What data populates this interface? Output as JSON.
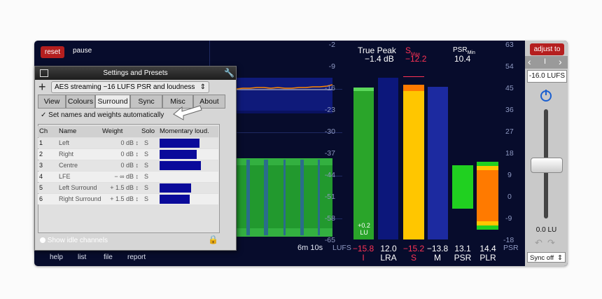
{
  "topbar": {
    "reset_label": "reset",
    "pause_label": "pause"
  },
  "bottombar": {
    "help": "help",
    "list": "list",
    "file": "file",
    "report": "report"
  },
  "graph": {
    "elapsed": "6m 10s",
    "axis_unit": "LUFS",
    "lufs_ticks": [
      "-2",
      "-9",
      "-16",
      "-23",
      "-30",
      "-37",
      "-44",
      "-51",
      "-58",
      "-65"
    ]
  },
  "header": {
    "true_peak_label": "True Peak",
    "true_peak_value": "−1.4 dB",
    "smax_label": "S",
    "smax_sub": "Max",
    "smax_value": "−12.2",
    "psrmin_label": "PSR",
    "psrmin_sub": "Min",
    "psrmin_value": "10.4"
  },
  "psr_ticks": [
    "63",
    "54",
    "45",
    "36",
    "27",
    "18",
    "9",
    "0",
    "-9",
    "-18"
  ],
  "psr_axis_label": "PSR",
  "meters": {
    "i_value": "−15.8",
    "i_label": "I",
    "i_badge": "+0.2",
    "i_badge_unit": "LU",
    "lra_value": "12.0",
    "lra_label": "LRA",
    "s_value": "−15.2",
    "s_label": "S",
    "m_value": "−13.8",
    "m_label": "M",
    "psr_value": "13.1",
    "psr_label": "PSR",
    "plr_value": "14.4",
    "plr_label": "PLR"
  },
  "sidebar": {
    "adjust_label": "adjust to",
    "target": "-16.0 LUFS",
    "lu_value": "0.0 LU",
    "sync_label": "Sync off"
  },
  "settings": {
    "title": "Settings and Presets",
    "preset": "AES streaming −16 LUFS PSR and loudness",
    "tabs": [
      "View",
      "Colours",
      "Surround",
      "Sync",
      "Misc",
      "About"
    ],
    "active_tab": "Surround",
    "auto_checkbox": "Set names and weights automatically",
    "columns": [
      "Ch",
      "Name",
      "Weight",
      "Solo",
      "Momentary loud."
    ],
    "rows": [
      {
        "ch": "1",
        "name": "Left",
        "weight": "0 dB",
        "solo": "S",
        "level": 0.73
      },
      {
        "ch": "2",
        "name": "Right",
        "weight": "0 dB",
        "solo": "S",
        "level": 0.68
      },
      {
        "ch": "3",
        "name": "Centre",
        "weight": "0 dB",
        "solo": "S",
        "level": 0.76
      },
      {
        "ch": "4",
        "name": "LFE",
        "weight": "− ∞ dB",
        "solo": "S",
        "level": 0
      },
      {
        "ch": "5",
        "name": "Left Surround",
        "weight": "+ 1.5 dB",
        "solo": "S",
        "level": 0.58
      },
      {
        "ch": "6",
        "name": "Right Surround",
        "weight": "+ 1.5 dB",
        "solo": "S",
        "level": 0.55
      }
    ],
    "idle_label": "Show idle channels"
  },
  "colors": {
    "background": "#070c2c",
    "accent_red": "#b51f1f",
    "meter_green": "#2aa52a",
    "meter_yellow": "#ffc600",
    "meter_blue": "#1f2a8a",
    "orange": "#ff7a00"
  }
}
